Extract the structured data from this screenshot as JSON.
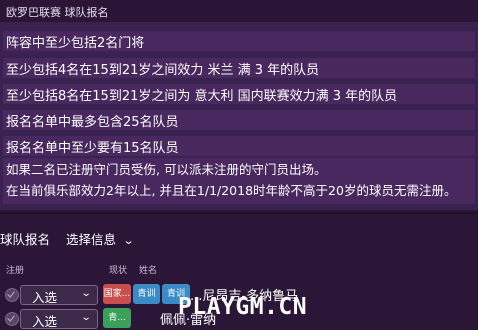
{
  "window": {
    "title": "欧罗巴联赛 球队报名"
  },
  "rules": [
    "阵容中至少包括2名门将",
    "至少包括4名在15到21岁之间效力 米兰 满 3 年的队员",
    "至少包括8名在15到21岁之间为 意大利 国内联赛效力满 3 年的队员",
    "报名名单中最多包含25名队员",
    "报名名单中至少要有15名队员"
  ],
  "notes": [
    "如果二名已注册守门员受伤, 可以派未注册的守门员出场。",
    "在当前俱乐部效力2年以上, 并且在1/1/2018时年龄不高于20岁的球员无需注册。"
  ],
  "tabs": {
    "squad": "球队报名",
    "select": "选择信息"
  },
  "columns": {
    "register": "注册",
    "status": "现状",
    "name": "姓名"
  },
  "players": [
    {
      "status": "入选",
      "badges": [
        "国家...",
        "青训",
        "青训"
      ],
      "name": "...尼昂吉-多纳鲁马"
    },
    {
      "status": "入选",
      "badges": [
        "青..."
      ],
      "name": "佩佩·雷纳"
    }
  ],
  "watermark": "PLAYGM.CN",
  "colors": {
    "badge_red": "#c94f4f",
    "badge_blue": "#3b8bc6",
    "badge_green": "#3aa05a"
  }
}
